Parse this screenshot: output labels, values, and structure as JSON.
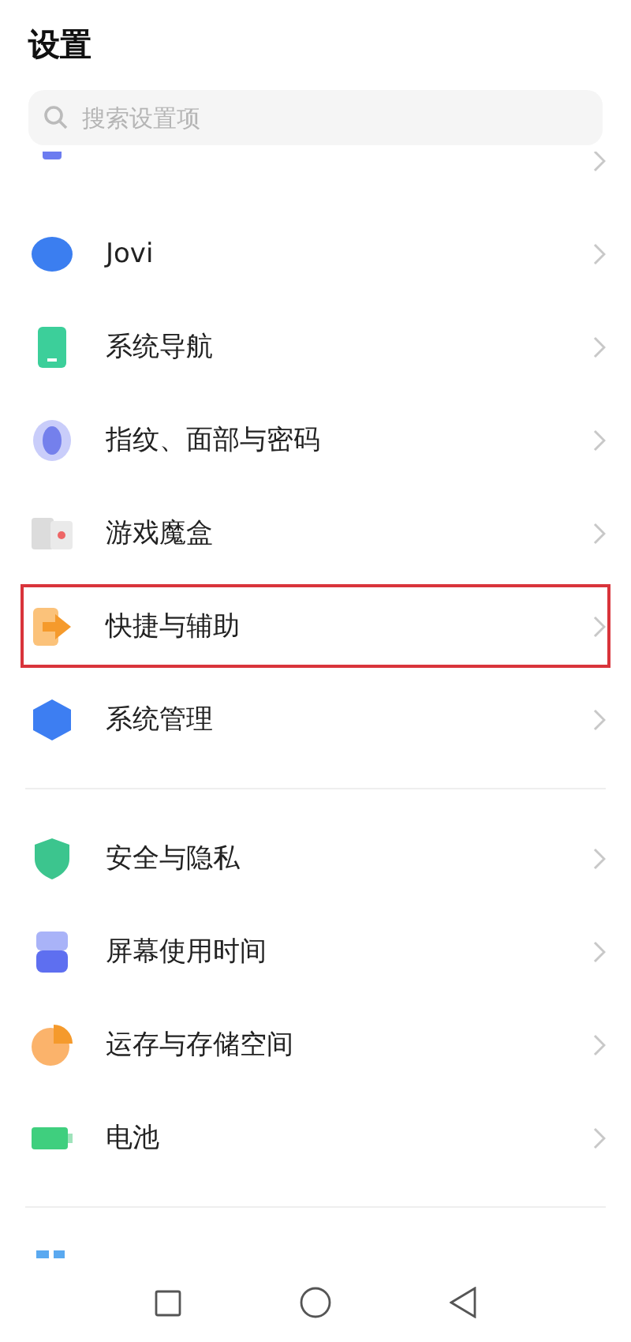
{
  "title": "设置",
  "search": {
    "placeholder": "搜索设置项"
  },
  "sections": [
    {
      "items": [
        {
          "label": "Jovi",
          "highlighted": false
        },
        {
          "label": "系统导航",
          "highlighted": false
        },
        {
          "label": "指纹、面部与密码",
          "highlighted": false
        },
        {
          "label": "游戏魔盒",
          "highlighted": false
        },
        {
          "label": "快捷与辅助",
          "highlighted": true
        },
        {
          "label": "系统管理",
          "highlighted": false
        }
      ]
    },
    {
      "items": [
        {
          "label": "安全与隐私",
          "highlighted": false
        },
        {
          "label": "屏幕使用时间",
          "highlighted": false
        },
        {
          "label": "运存与存储空间",
          "highlighted": false
        },
        {
          "label": "电池",
          "highlighted": false
        }
      ]
    }
  ]
}
